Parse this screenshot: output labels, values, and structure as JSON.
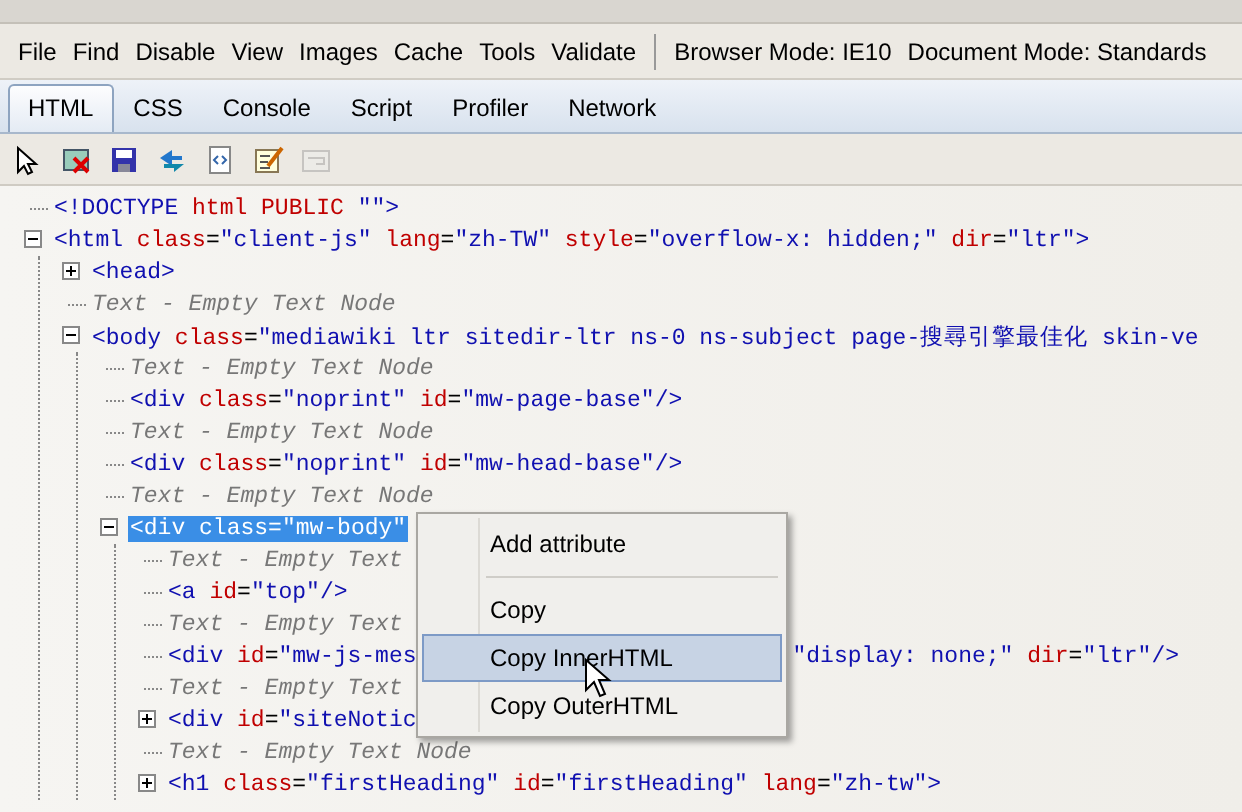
{
  "menu_bar": {
    "items": [
      "File",
      "Find",
      "Disable",
      "View",
      "Images",
      "Cache",
      "Tools",
      "Validate"
    ],
    "modes": [
      "Browser Mode: IE10",
      "Document Mode: Standards"
    ]
  },
  "tabs": [
    {
      "label": "HTML",
      "selected": true
    },
    {
      "label": "CSS",
      "selected": false
    },
    {
      "label": "Console",
      "selected": false
    },
    {
      "label": "Script",
      "selected": false
    },
    {
      "label": "Profiler",
      "selected": false
    },
    {
      "label": "Network",
      "selected": false
    }
  ],
  "toolbar": [
    {
      "disabled": false
    },
    {
      "disabled": false
    },
    {
      "disabled": false
    },
    {
      "disabled": false
    },
    {
      "disabled": false
    },
    {
      "disabled": false
    },
    {
      "disabled": true
    }
  ],
  "tree": [
    {
      "selected": false,
      "tokens": [
        {
          "text": "<!DOCTYPE",
          "kind": "tag"
        },
        {
          "text": " html PUBLIC ",
          "kind": "attr"
        },
        {
          "text": "\"\"",
          "kind": "val"
        },
        {
          "text": ">",
          "kind": "tag"
        }
      ]
    },
    {
      "selected": false,
      "expanded": true,
      "tokens": [
        {
          "text": "<html",
          "kind": "tag"
        },
        {
          "text": " class",
          "kind": "attr"
        },
        {
          "text": "=",
          "kind": "eq"
        },
        {
          "text": "\"client-js\"",
          "kind": "val"
        },
        {
          "text": " lang",
          "kind": "attr"
        },
        {
          "text": "=",
          "kind": "eq"
        },
        {
          "text": "\"zh-TW\"",
          "kind": "val"
        },
        {
          "text": " style",
          "kind": "attr"
        },
        {
          "text": "=",
          "kind": "eq"
        },
        {
          "text": "\"overflow-x: hidden;\"",
          "kind": "val"
        },
        {
          "text": " dir",
          "kind": "attr"
        },
        {
          "text": "=",
          "kind": "eq"
        },
        {
          "text": "\"ltr\"",
          "kind": "val"
        },
        {
          "text": ">",
          "kind": "tag"
        }
      ],
      "children": [
        {
          "selected": false,
          "expanded": false,
          "tokens": [
            {
              "text": "<head>",
              "kind": "tag"
            }
          ]
        },
        {
          "selected": false,
          "tokens": [
            {
              "text": "Text - Empty Text Node",
              "kind": "text"
            }
          ]
        },
        {
          "selected": false,
          "expanded": true,
          "tokens": [
            {
              "text": "<body",
              "kind": "tag"
            },
            {
              "text": " class",
              "kind": "attr"
            },
            {
              "text": "=",
              "kind": "eq"
            },
            {
              "text": "\"mediawiki ltr sitedir-ltr ns-0 ns-subject page-搜尋引擎最佳化 skin-ve",
              "kind": "val"
            }
          ],
          "children": [
            {
              "selected": false,
              "tokens": [
                {
                  "text": "Text - Empty Text Node",
                  "kind": "text"
                }
              ]
            },
            {
              "selected": false,
              "tokens": [
                {
                  "text": "<div",
                  "kind": "tag"
                },
                {
                  "text": " class",
                  "kind": "attr"
                },
                {
                  "text": "=",
                  "kind": "eq"
                },
                {
                  "text": "\"noprint\"",
                  "kind": "val"
                },
                {
                  "text": " id",
                  "kind": "attr"
                },
                {
                  "text": "=",
                  "kind": "eq"
                },
                {
                  "text": "\"mw-page-base\"",
                  "kind": "val"
                },
                {
                  "text": "/>",
                  "kind": "tag"
                }
              ]
            },
            {
              "selected": false,
              "tokens": [
                {
                  "text": "Text - Empty Text Node",
                  "kind": "text"
                }
              ]
            },
            {
              "selected": false,
              "tokens": [
                {
                  "text": "<div",
                  "kind": "tag"
                },
                {
                  "text": " class",
                  "kind": "attr"
                },
                {
                  "text": "=",
                  "kind": "eq"
                },
                {
                  "text": "\"noprint\"",
                  "kind": "val"
                },
                {
                  "text": " id",
                  "kind": "attr"
                },
                {
                  "text": "=",
                  "kind": "eq"
                },
                {
                  "text": "\"mw-head-base\"",
                  "kind": "val"
                },
                {
                  "text": "/>",
                  "kind": "tag"
                }
              ]
            },
            {
              "selected": false,
              "tokens": [
                {
                  "text": "Text - Empty Text Node",
                  "kind": "text"
                }
              ]
            },
            {
              "selected": true,
              "expanded": true,
              "tokens": [
                {
                  "text": "<div",
                  "kind": "tag"
                },
                {
                  "text": " class",
                  "kind": "attr"
                },
                {
                  "text": "=",
                  "kind": "eq"
                },
                {
                  "text": "\"mw-body\"",
                  "kind": "val"
                }
              ],
              "children": [
                {
                  "selected": false,
                  "tokens": [
                    {
                      "text": "Text - Empty Text",
                      "kind": "text"
                    }
                  ]
                },
                {
                  "selected": false,
                  "tokens": [
                    {
                      "text": "<a",
                      "kind": "tag"
                    },
                    {
                      "text": " id",
                      "kind": "attr"
                    },
                    {
                      "text": "=",
                      "kind": "eq"
                    },
                    {
                      "text": "\"top\"",
                      "kind": "val"
                    },
                    {
                      "text": "/>",
                      "kind": "tag"
                    }
                  ]
                },
                {
                  "selected": false,
                  "tokens": [
                    {
                      "text": "Text - Empty Text",
                      "kind": "text"
                    }
                  ]
                },
                {
                  "selected": false,
                  "tokens": [
                    {
                      "text": "<div",
                      "kind": "tag"
                    },
                    {
                      "text": " id",
                      "kind": "attr"
                    },
                    {
                      "text": "=",
                      "kind": "eq"
                    },
                    {
                      "text": "\"mw-js-mes",
                      "kind": "val"
                    }
                  ],
                  "tail": [
                    {
                      "text": "\"display: none;\"",
                      "kind": "val"
                    },
                    {
                      "text": " dir",
                      "kind": "attr"
                    },
                    {
                      "text": "=",
                      "kind": "eq"
                    },
                    {
                      "text": "\"ltr\"",
                      "kind": "val"
                    },
                    {
                      "text": "/>",
                      "kind": "tag"
                    }
                  ]
                },
                {
                  "selected": false,
                  "tokens": [
                    {
                      "text": "Text - Empty Text",
                      "kind": "text"
                    }
                  ]
                },
                {
                  "selected": false,
                  "expanded": false,
                  "tokens": [
                    {
                      "text": "<div",
                      "kind": "tag"
                    },
                    {
                      "text": " id",
                      "kind": "attr"
                    },
                    {
                      "text": "=",
                      "kind": "eq"
                    },
                    {
                      "text": "\"siteNotic",
                      "kind": "val"
                    }
                  ]
                },
                {
                  "selected": false,
                  "tokens": [
                    {
                      "text": "Text - Empty Text Node",
                      "kind": "text"
                    }
                  ]
                },
                {
                  "selected": false,
                  "expanded": false,
                  "tokens": [
                    {
                      "text": "<h1",
                      "kind": "tag"
                    },
                    {
                      "text": " class",
                      "kind": "attr"
                    },
                    {
                      "text": "=",
                      "kind": "eq"
                    },
                    {
                      "text": "\"firstHeading\"",
                      "kind": "val"
                    },
                    {
                      "text": " id",
                      "kind": "attr"
                    },
                    {
                      "text": "=",
                      "kind": "eq"
                    },
                    {
                      "text": "\"firstHeading\"",
                      "kind": "val"
                    },
                    {
                      "text": " lang",
                      "kind": "attr"
                    },
                    {
                      "text": "=",
                      "kind": "eq"
                    },
                    {
                      "text": "\"zh-tw\"",
                      "kind": "val"
                    },
                    {
                      "text": ">",
                      "kind": "tag"
                    }
                  ]
                }
              ]
            }
          ]
        }
      ]
    }
  ],
  "context_menu": [
    {
      "kind": "item",
      "label": "Add attribute",
      "selected": false
    },
    {
      "kind": "separator"
    },
    {
      "kind": "item",
      "label": "Copy",
      "selected": false
    },
    {
      "kind": "item",
      "label": "Copy InnerHTML",
      "selected": true
    },
    {
      "kind": "item",
      "label": "Copy OuterHTML",
      "selected": false
    }
  ]
}
